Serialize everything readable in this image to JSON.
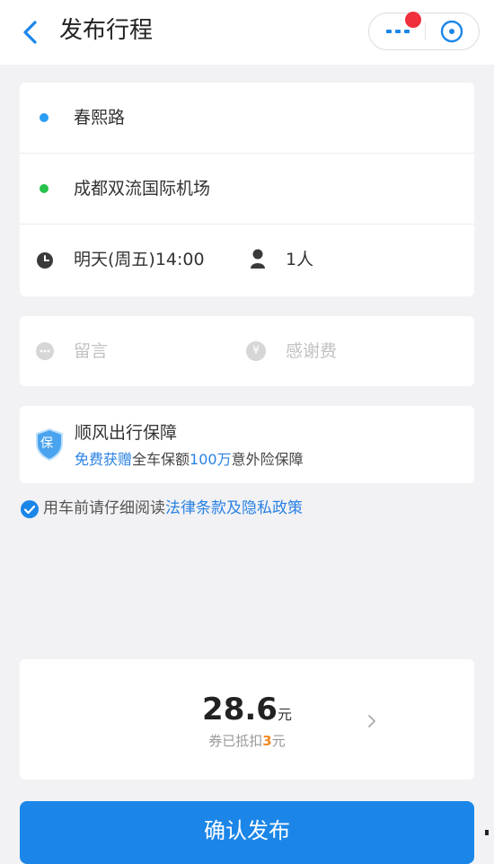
{
  "header": {
    "title": "发布行程",
    "icons": {
      "back": "back-chevron-icon",
      "more": "more-dots-icon",
      "close": "close-circle-icon"
    },
    "accent": "#1b86e8",
    "notification_dot_color": "#f0303c"
  },
  "route": {
    "origin": "春熙路",
    "destination": "成都双流国际机场",
    "time": "明天(周五)14:00",
    "passengers": "1人",
    "origin_dot_color": "#2a9df4",
    "destination_dot_color": "#27c24c"
  },
  "extras": {
    "message_placeholder": "留言",
    "tip_placeholder": "感谢费",
    "tip_symbol": "¥"
  },
  "insurance": {
    "title": "顺风出行保障",
    "badge": "保",
    "sub_free": "免费获赠",
    "sub_mid": "全车保额",
    "sub_amount": "100万",
    "sub_end": "意外险保障"
  },
  "agreement": {
    "checked": true,
    "prefix": "用车前请仔细阅读",
    "link": "法律条款及隐私政策"
  },
  "price": {
    "amount": "28.6",
    "unit": "元",
    "coupon_prefix": "券已抵扣",
    "coupon_value": "3",
    "coupon_unit": "元"
  },
  "actions": {
    "confirm_label": "确认发布"
  }
}
